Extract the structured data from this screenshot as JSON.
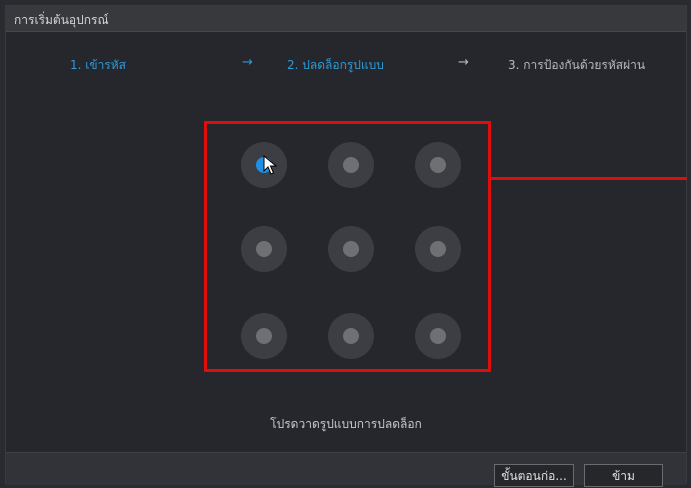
{
  "window": {
    "title": "การเริ่มต้นอุปกรณ์"
  },
  "steps": [
    {
      "label": "1.  เข้ารหัส",
      "state": "done"
    },
    {
      "label": "2.  ปลดล็อกรูปแบบ",
      "state": "active"
    },
    {
      "label": "3.  การป้องกันด้วยรหัสผ่าน",
      "state": "pending"
    }
  ],
  "step_arrow": "→",
  "pattern": {
    "rows": 3,
    "cols": 3,
    "selected_index": 0
  },
  "hint": "โปรดวาดรูปแบบการปลดล็อก",
  "footer": {
    "previous_label": "ขั้นตอนก่อ...",
    "skip_label": "ข้าม"
  },
  "colors": {
    "accent": "#2e9bd9",
    "highlight_box": "#e00d0d",
    "selected_dot": "#1f8fe6"
  }
}
